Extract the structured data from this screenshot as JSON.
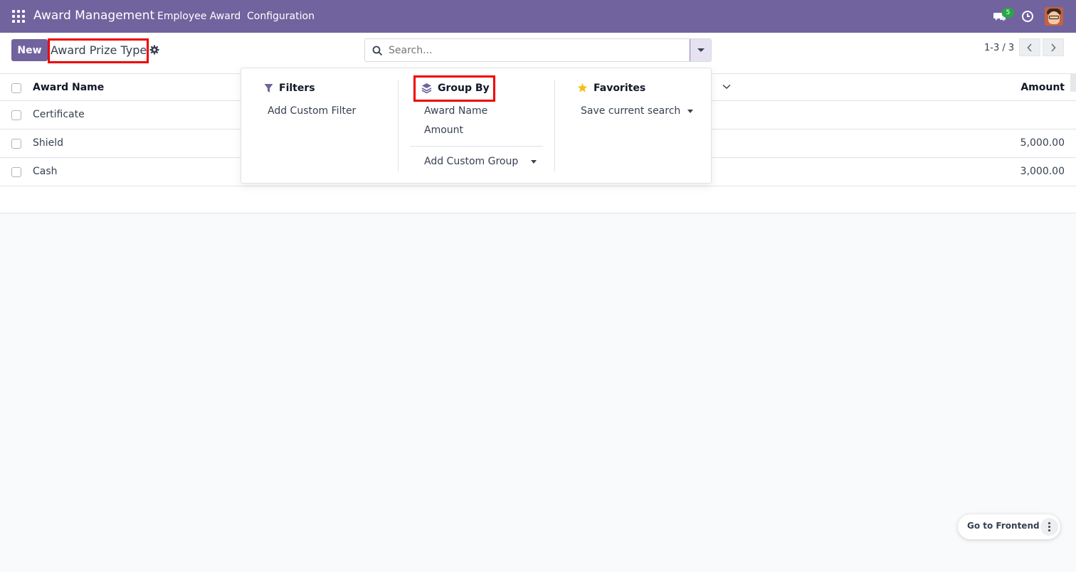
{
  "navbar": {
    "app_title": "Award Management",
    "menu": [
      "Employee Award",
      "Configuration"
    ],
    "chat_badge": "5",
    "color": "#71639e"
  },
  "control": {
    "new_label": "New",
    "breadcrumb": "Award Prize Type",
    "search_placeholder": "Search...",
    "pager": "1-3 / 3"
  },
  "table": {
    "columns": [
      "Award Name",
      "Amount"
    ],
    "rows": [
      {
        "name": "Certificate",
        "amount": ""
      },
      {
        "name": "Shield",
        "amount": "5,000.00"
      },
      {
        "name": "Cash",
        "amount": "3,000.00"
      }
    ]
  },
  "dropdown": {
    "filters": {
      "title": "Filters",
      "items": [
        "Add Custom Filter"
      ]
    },
    "groupby": {
      "title": "Group By",
      "items": [
        "Award Name",
        "Amount"
      ],
      "custom": "Add Custom Group"
    },
    "favorites": {
      "title": "Favorites",
      "items": [
        "Save current search"
      ]
    }
  },
  "floating": {
    "frontend_label": "Go to Frontend"
  },
  "icons": [
    "apps-icon",
    "chat-icon",
    "clock-icon",
    "gear-icon",
    "search-icon",
    "filter-icon",
    "layers-icon",
    "star-icon",
    "chevron-left-icon",
    "chevron-right-icon",
    "kebab-icon"
  ]
}
